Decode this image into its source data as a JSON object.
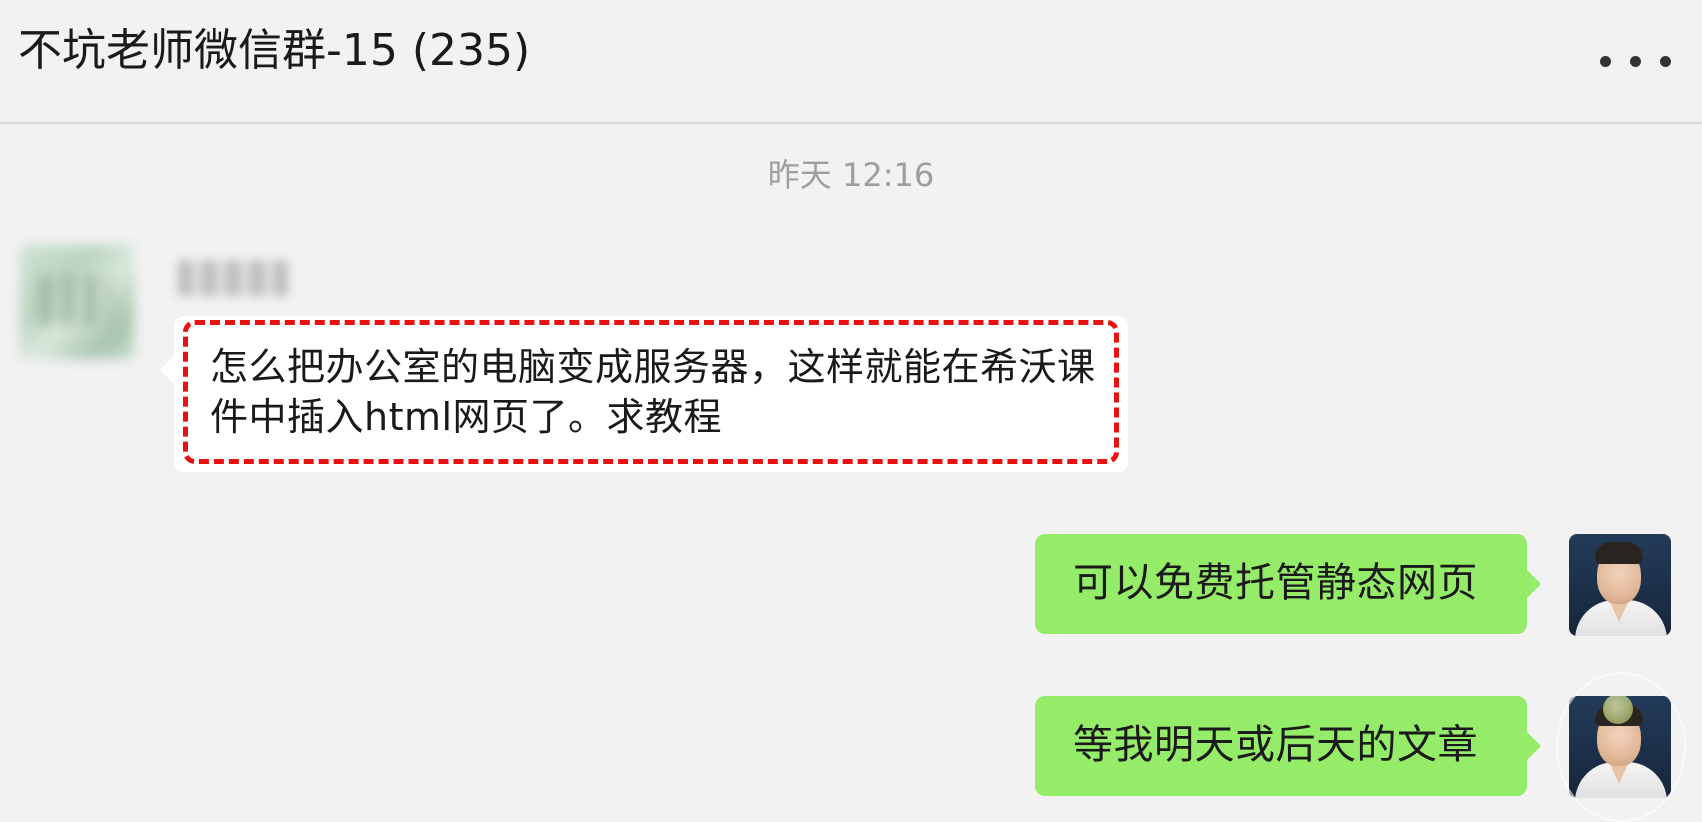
{
  "header": {
    "title": "不坑老师微信群-15 (235)",
    "more_icon": "more-horizontal-icon"
  },
  "chat": {
    "timestamp": "昨天 12:16",
    "messages": [
      {
        "side": "left",
        "text": "怎么把办公室的电脑变成服务器，这样就能在希沃课件中插入html网页了。求教程"
      },
      {
        "side": "right",
        "text": "可以免费托管静态网页"
      },
      {
        "side": "right",
        "text": "等我明天或后天的文章"
      }
    ]
  },
  "colors": {
    "background": "#f2f2f2",
    "self_bubble": "#95ec69",
    "other_bubble": "#ffffff",
    "highlight_border": "#e8110f"
  }
}
